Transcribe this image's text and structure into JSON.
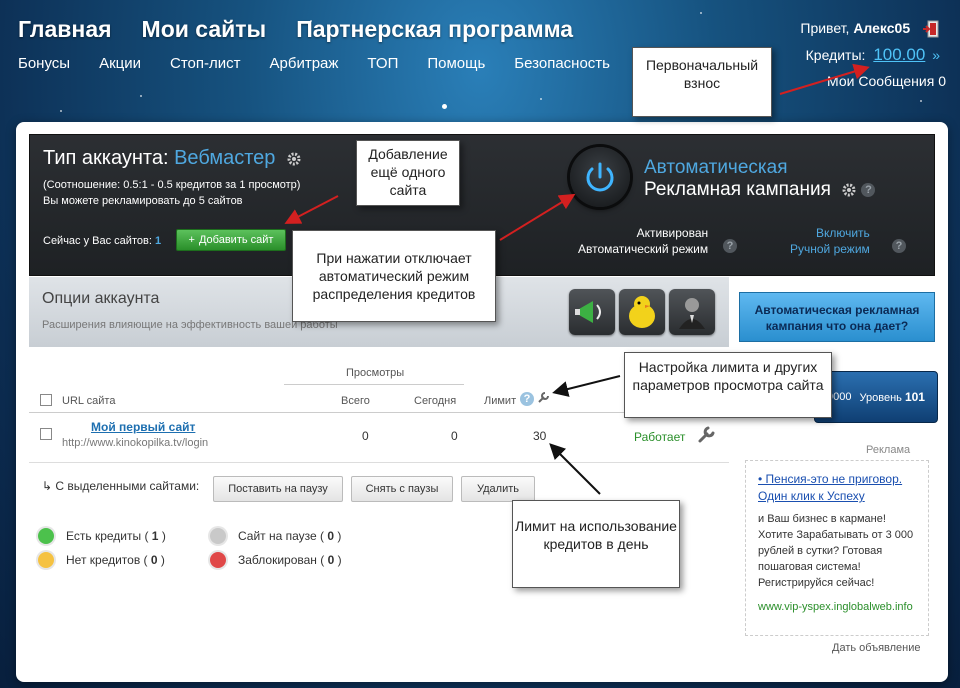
{
  "nav": {
    "main": [
      "Главная",
      "Мои сайты",
      "Партнерская программа"
    ],
    "sub": [
      "Бонусы",
      "Акции",
      "Стоп-лист",
      "Арбитраж",
      "ТОП",
      "Помощь",
      "Безопасность"
    ]
  },
  "user": {
    "greeting": "Привет,",
    "name": "Алекс05",
    "credits_label": "Кредиты:",
    "credits_value": "100.00",
    "messages": "Мои Сообщения 0"
  },
  "account": {
    "type_label": "Тип аккаунта:",
    "type_value": "Вебмастер",
    "ratio_line1": "(Соотношение: 0.5:1 - 0.5 кредитов за 1 просмотр)",
    "ratio_line2": "Вы можете рекламировать до 5 сайтов",
    "sites_label": "Сейчас у Вас сайтов:",
    "sites_count": "1",
    "add_button": "Добавить сайт"
  },
  "campaign": {
    "title": "Автоматическая",
    "subtitle": "Рекламная кампания",
    "status_line1": "Активирован",
    "status_line2": "Автоматический режим",
    "manual_line1": "Включить",
    "manual_line2": "Ручной режим"
  },
  "options": {
    "title": "Опции аккаунта",
    "desc": "Расширения влияющие на эффективность вашей работы"
  },
  "banner": {
    "line1": "Автоматическая рекламная",
    "line2": "кампания что она дает?"
  },
  "table": {
    "views_header": "Просмотры",
    "col_url": "URL сайта",
    "col_total": "Всего",
    "col_today": "Сегодня",
    "col_limit": "Лимит",
    "rows": [
      {
        "name": "Мой первый сайт",
        "url": "http://www.kinokopilka.tv/login",
        "total": "0",
        "today": "0",
        "limit": "30",
        "status": "Работает"
      }
    ]
  },
  "bulk": {
    "label": "С выделенными сайтами:",
    "pause": "Поставить на паузу",
    "unpause": "Снять с паузы",
    "delete": "Удалить"
  },
  "legend": [
    {
      "label": "Есть кредиты (",
      "count": "1",
      "color": "#4cc14c"
    },
    {
      "label": "Нет кредитов (",
      "count": "0",
      "color": "#f5c242"
    },
    {
      "label": "Сайт на паузе (",
      "count": "0",
      "color": "#c9c9c9"
    },
    {
      "label": "Заблокирован (",
      "count": "0",
      "color": "#e04848"
    }
  ],
  "rank": {
    "points": "9000",
    "level_label": "Уровень",
    "level": "101"
  },
  "ad": {
    "label": "Реклама",
    "title": "• Пенсия-это не приговор. Один клик к Успеху",
    "text": "и Ваш бизнес в кармане! Хотите Зарабатывать от 3 000 рублей в сутки? Готовая пошаговая система! Регистрируйся сейчас!",
    "url": "www.vip-yspex.inglobalweb.info",
    "footer": "Дать объявление"
  },
  "callouts": {
    "initial": "Первоначальный взнос",
    "add_one": "Добавление ещё одного сайта",
    "disable_auto": "При нажатии отключает автоматический режим распределения кредитов",
    "limit_settings": "Настройка лимита и других параметров просмотра сайта",
    "daily_limit": "Лимит на использование кредитов в день"
  },
  "colors": {
    "accent": "#4fa8e0",
    "green": "#2a8f2a",
    "link": "#1d6fb0"
  }
}
